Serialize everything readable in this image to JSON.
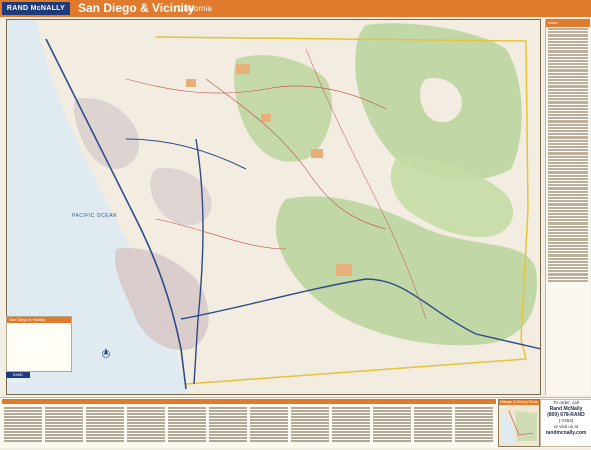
{
  "header": {
    "brand": "RAND McNALLY",
    "title": "San Diego & Vicinity",
    "subtitle": "California"
  },
  "map": {
    "ocean_label": "PACIFIC OCEAN",
    "legend_title": "San Diego & Vicinity",
    "legend_brand": "RAND McNALLY"
  },
  "sidebar": {
    "index_title": "Index"
  },
  "inset": {
    "title": "Mileage & Driving Times Map"
  },
  "contact": {
    "line1": "To order, call",
    "line2": "Rand McNally",
    "line3": "(800) 678-RAND",
    "line4": "(-7263)",
    "line5": "or visit us at",
    "line6": "randmcnally.com"
  },
  "colors": {
    "header": "#e07a2c",
    "brand_blue": "#1f3a7a",
    "ocean": "#dfeaf1",
    "land": "#f2ede0",
    "forest": "#b9d29a",
    "urban": "#d7c9c9",
    "highway": "#2f4a8a",
    "border": "#e6c43a"
  }
}
